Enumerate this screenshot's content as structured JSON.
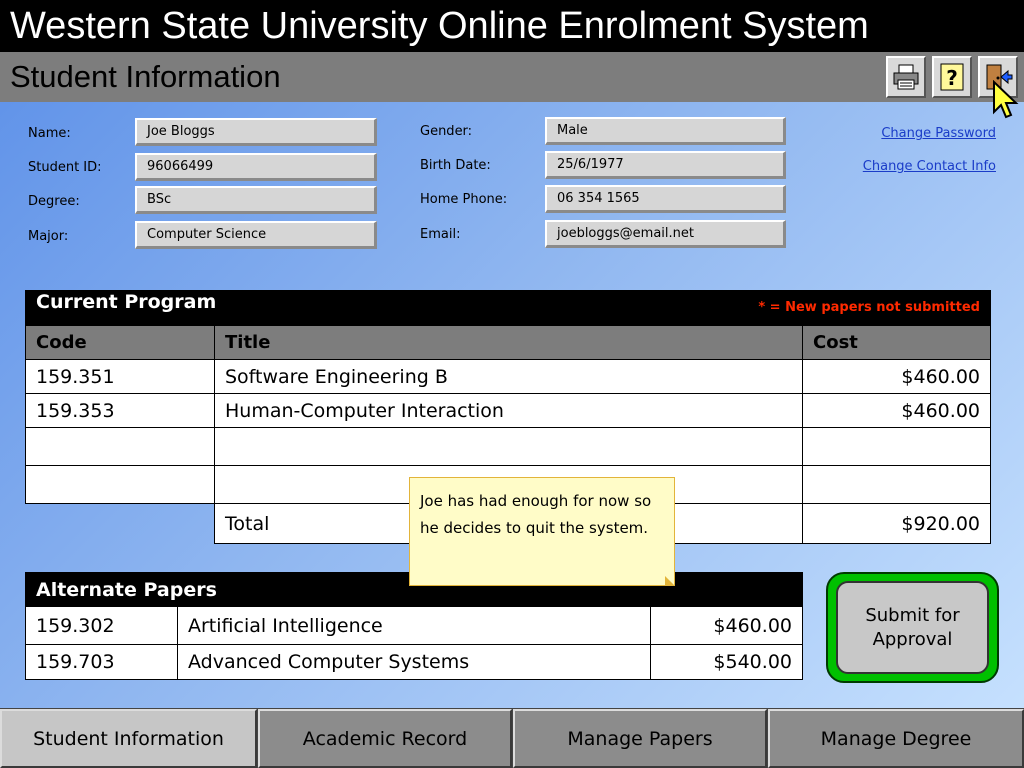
{
  "app": {
    "title": "Western State University Online Enrolment System",
    "page_title": "Student Information"
  },
  "toolbar": {
    "icons": [
      "printer-icon",
      "help-icon",
      "exit-door-icon"
    ]
  },
  "student": {
    "labels": {
      "name": "Name:",
      "student_id": "Student ID:",
      "degree": "Degree:",
      "major": "Major:",
      "gender": "Gender:",
      "birth_date": "Birth Date:",
      "home_phone": "Home Phone:",
      "email": "Email:"
    },
    "values": {
      "name": "Joe Bloggs",
      "student_id": "96066499",
      "degree": "BSc",
      "major": "Computer Science",
      "gender": "Male",
      "birth_date": "25/6/1977",
      "home_phone": "06 354 1565",
      "email": "joebloggs@email.net"
    }
  },
  "links": {
    "change_password": "Change Password",
    "change_contact": "Change Contact Info"
  },
  "current_program": {
    "title": "Current Program",
    "note": "* = New papers not submitted",
    "columns": [
      "Code",
      "Title",
      "Cost"
    ],
    "rows": [
      {
        "code": "159.351",
        "title": "Software Engineering B",
        "cost": "$460.00"
      },
      {
        "code": "159.353",
        "title": "Human-Computer Interaction",
        "cost": "$460.00"
      },
      {
        "code": "",
        "title": "",
        "cost": ""
      },
      {
        "code": "",
        "title": "",
        "cost": ""
      }
    ],
    "total_label": "Total",
    "total_value": "$920.00"
  },
  "alternate_papers": {
    "title": "Alternate Papers",
    "rows": [
      {
        "code": "159.302",
        "title": "Artificial Intelligence",
        "cost": "$460.00"
      },
      {
        "code": "159.703",
        "title": "Advanced Computer Systems",
        "cost": "$540.00"
      }
    ]
  },
  "sticky_note": "Joe has had enough for now so he decides to quit the system.",
  "submit_button": "Submit for Approval",
  "tabs": [
    {
      "label": "Student Information",
      "active": true
    },
    {
      "label": "Academic Record",
      "active": false
    },
    {
      "label": "Manage Papers",
      "active": false
    },
    {
      "label": "Manage Degree",
      "active": false
    }
  ],
  "colors": {
    "title_bg": "#000000",
    "subbar_bg": "#7d7d7d",
    "submit_green": "#00c000",
    "note_red": "#ff2a00",
    "link_blue": "#1a3cc8"
  }
}
